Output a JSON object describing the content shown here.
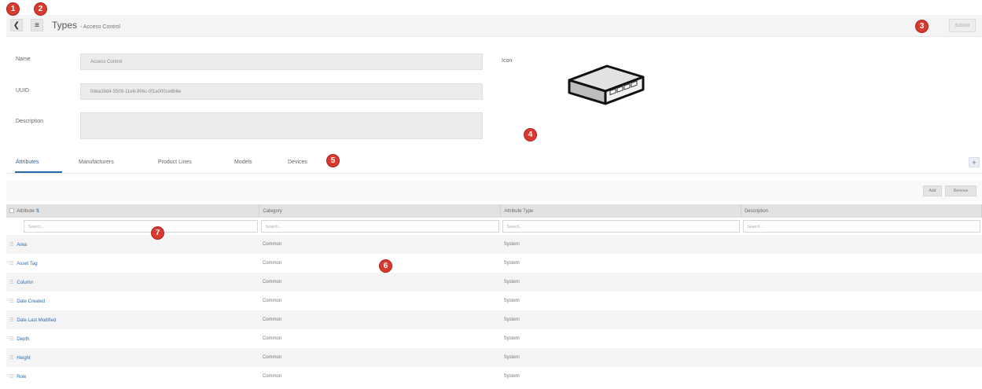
{
  "header": {
    "title": "Types",
    "subtitle": "- Access Control",
    "submit_label": "Submit",
    "back_icon": "back-arrow-icon",
    "menu_icon": "menu-icon"
  },
  "form": {
    "name_label": "Name",
    "name_value": "Access Control",
    "uuid_label": "UUID",
    "uuid_value": "0dea39d4-5509-11e6-996c-0f1a000ce8b6e",
    "description_label": "Description",
    "description_value": "",
    "icon_label": "Icon"
  },
  "tabs": [
    {
      "label": "Attributes",
      "active": true
    },
    {
      "label": "Manufacturers"
    },
    {
      "label": "Product Lines"
    },
    {
      "label": "Models"
    },
    {
      "label": "Devices"
    }
  ],
  "toolbar": {
    "add_label": "Add",
    "remove_label": "Remove",
    "plus_label": "+"
  },
  "table": {
    "columns": [
      "Attribute",
      "Category",
      "Attribute Type",
      "Description"
    ],
    "search_placeholder": "Search...",
    "rows": [
      {
        "attribute": "Area",
        "category": "Common",
        "type": "System",
        "description": ""
      },
      {
        "attribute": "Asset Tag",
        "category": "Common",
        "type": "System",
        "description": ""
      },
      {
        "attribute": "Column",
        "category": "Common",
        "type": "System",
        "description": ""
      },
      {
        "attribute": "Date Created",
        "category": "Common",
        "type": "System",
        "description": ""
      },
      {
        "attribute": "Date Last Modified",
        "category": "Common",
        "type": "System",
        "description": ""
      },
      {
        "attribute": "Depth",
        "category": "Common",
        "type": "System",
        "description": ""
      },
      {
        "attribute": "Height",
        "category": "Common",
        "type": "System",
        "description": ""
      },
      {
        "attribute": "Row",
        "category": "Common",
        "type": "System",
        "description": ""
      }
    ]
  },
  "annotations": [
    "1",
    "2",
    "3",
    "4",
    "5",
    "6",
    "7"
  ],
  "colors": {
    "accent": "#2d6aa8",
    "badge": "#d83a2e"
  }
}
